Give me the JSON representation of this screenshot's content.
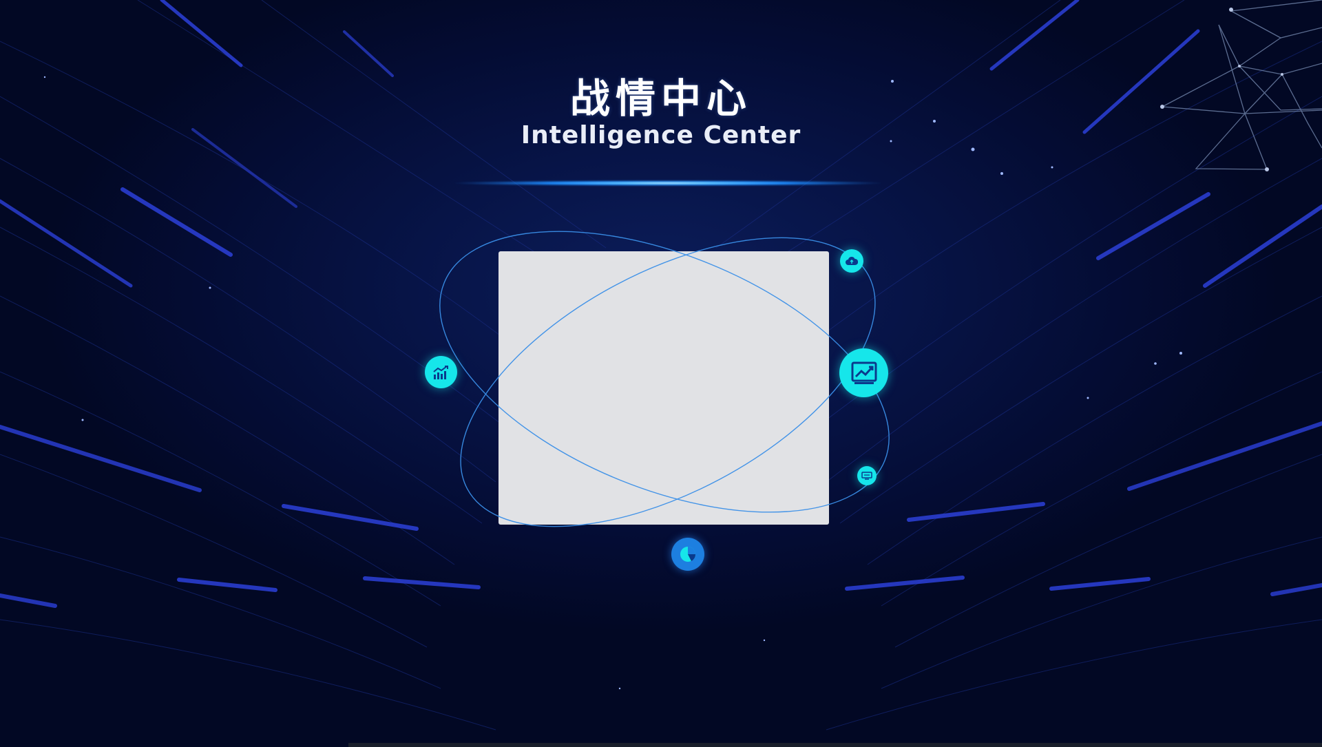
{
  "header": {
    "title": "战情中心",
    "subtitle": "Intelligence Center"
  },
  "colors": {
    "background": "#030a2a",
    "accent": "#16e6ea",
    "orbit": "#3a8fe8",
    "panel": "#e1e2e5"
  },
  "nodes": [
    {
      "name": "cloud-node",
      "icon": "cloud-icon"
    },
    {
      "name": "bar-chart-node",
      "icon": "bar-chart-icon"
    },
    {
      "name": "trend-chart-node",
      "icon": "trend-chart-icon"
    },
    {
      "name": "monitor-node",
      "icon": "monitor-icon"
    },
    {
      "name": "pie-chart-node",
      "icon": "pie-chart-icon"
    }
  ]
}
